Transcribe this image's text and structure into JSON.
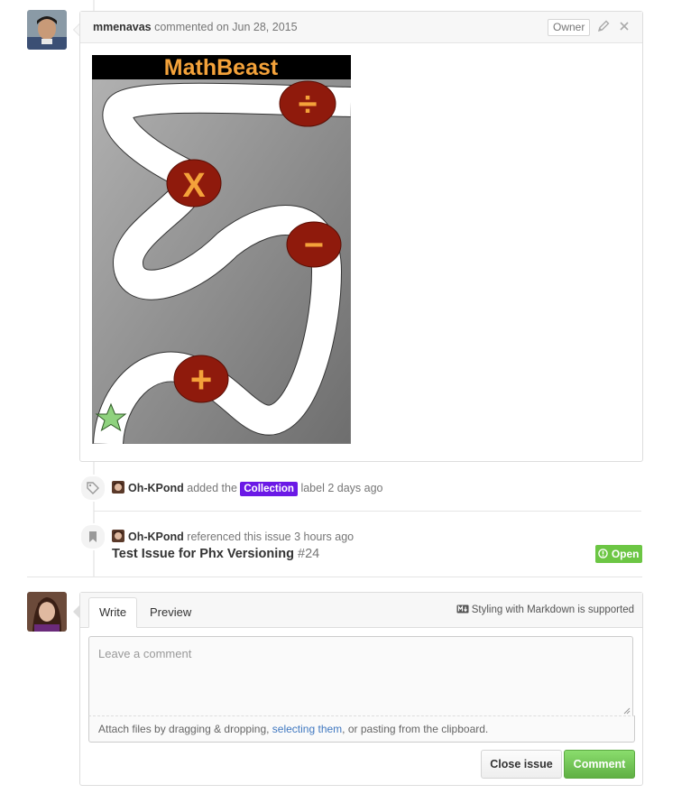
{
  "comment": {
    "author": "mmenavas",
    "action": "commented on Jun 28, 2015",
    "owner_badge": "Owner",
    "image": {
      "title": "MathBeast",
      "colors": {
        "banner": "#000000",
        "title": "#f4a23a",
        "circle": "#8f1a0c",
        "star": "#8fd27e"
      },
      "operators": [
        "÷",
        "X",
        "−",
        "+"
      ]
    }
  },
  "timeline": {
    "label_event": {
      "actor": "Oh-KPond",
      "text_before": "added the",
      "label": "Collection",
      "text_after": "label 2 days ago"
    },
    "reference_event": {
      "actor": "Oh-KPond",
      "text": "referenced this issue 3 hours ago",
      "issue_title": "Test Issue for Phx Versioning",
      "issue_number": "#24",
      "status": "Open"
    }
  },
  "new_comment": {
    "tabs": [
      "Write",
      "Preview"
    ],
    "markdown_note": "Styling with Markdown is supported",
    "placeholder": "Leave a comment",
    "attach_before": "Attach files by dragging & dropping,",
    "attach_link": "selecting them",
    "attach_after": ", or pasting from the clipboard.",
    "close_button": "Close issue",
    "comment_button": "Comment"
  },
  "colors": {
    "open_green": "#6cc644",
    "label_purple": "#6b19e6",
    "link_blue": "#4078c0"
  }
}
